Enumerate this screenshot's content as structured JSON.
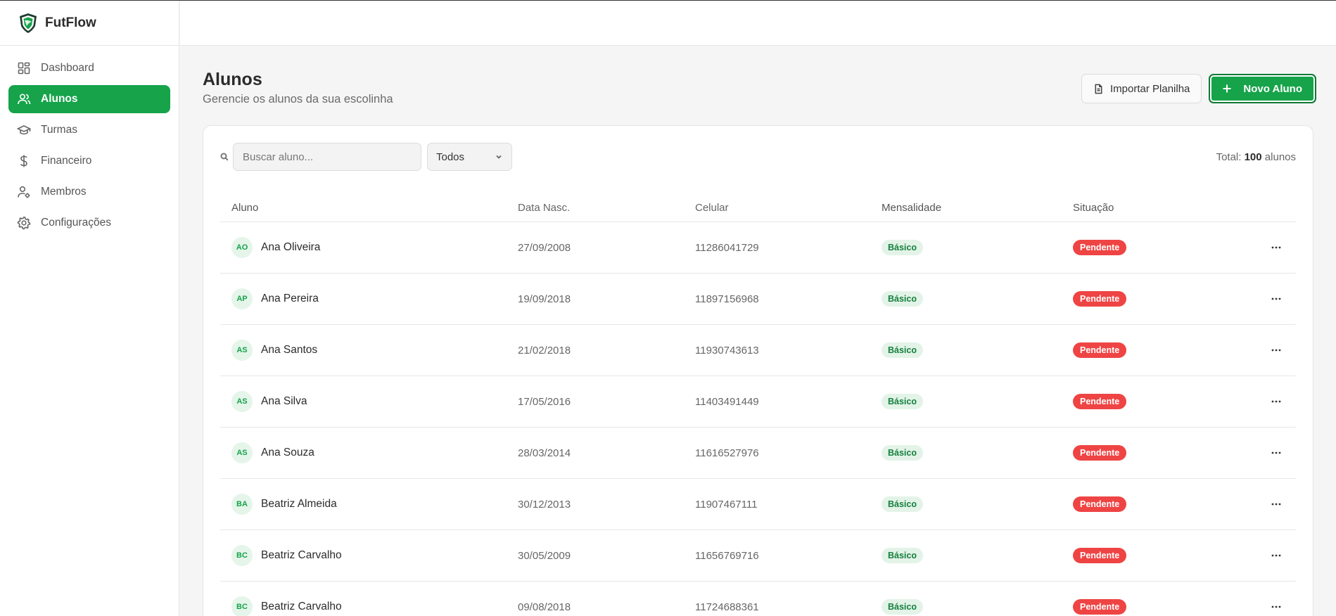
{
  "brand": {
    "name": "FutFlow"
  },
  "sidebar": {
    "items": [
      {
        "label": "Dashboard",
        "icon": "dashboard-icon",
        "active": false
      },
      {
        "label": "Alunos",
        "icon": "users-icon",
        "active": true
      },
      {
        "label": "Turmas",
        "icon": "graduation-cap-icon",
        "active": false
      },
      {
        "label": "Financeiro",
        "icon": "dollar-icon",
        "active": false
      },
      {
        "label": "Membros",
        "icon": "user-gear-icon",
        "active": false
      },
      {
        "label": "Configurações",
        "icon": "gear-icon",
        "active": false
      }
    ]
  },
  "page": {
    "title": "Alunos",
    "subtitle": "Gerencie os alunos da sua escolinha"
  },
  "actions": {
    "import_label": "Importar Planilha",
    "new_label": "Novo Aluno"
  },
  "toolbar": {
    "search_placeholder": "Buscar aluno...",
    "filter_value": "Todos",
    "total_prefix": "Total:",
    "total_count": "100",
    "total_suffix": "alunos"
  },
  "colors": {
    "accent": "#16a34a",
    "danger": "#ef4444"
  },
  "table": {
    "columns": [
      "Aluno",
      "Data Nasc.",
      "Celular",
      "Mensalidade",
      "Situação"
    ],
    "rows": [
      {
        "initials": "AO",
        "name": "Ana Oliveira",
        "birth": "27/09/2008",
        "phone": "11286041729",
        "plan": "Básico",
        "status": "Pendente"
      },
      {
        "initials": "AP",
        "name": "Ana Pereira",
        "birth": "19/09/2018",
        "phone": "11897156968",
        "plan": "Básico",
        "status": "Pendente"
      },
      {
        "initials": "AS",
        "name": "Ana Santos",
        "birth": "21/02/2018",
        "phone": "11930743613",
        "plan": "Básico",
        "status": "Pendente"
      },
      {
        "initials": "AS",
        "name": "Ana Silva",
        "birth": "17/05/2016",
        "phone": "11403491449",
        "plan": "Básico",
        "status": "Pendente"
      },
      {
        "initials": "AS",
        "name": "Ana Souza",
        "birth": "28/03/2014",
        "phone": "11616527976",
        "plan": "Básico",
        "status": "Pendente"
      },
      {
        "initials": "BA",
        "name": "Beatriz Almeida",
        "birth": "30/12/2013",
        "phone": "11907467111",
        "plan": "Básico",
        "status": "Pendente"
      },
      {
        "initials": "BC",
        "name": "Beatriz Carvalho",
        "birth": "30/05/2009",
        "phone": "11656769716",
        "plan": "Básico",
        "status": "Pendente"
      },
      {
        "initials": "BC",
        "name": "Beatriz Carvalho",
        "birth": "09/08/2018",
        "phone": "11724688361",
        "plan": "Básico",
        "status": "Pendente"
      }
    ]
  }
}
